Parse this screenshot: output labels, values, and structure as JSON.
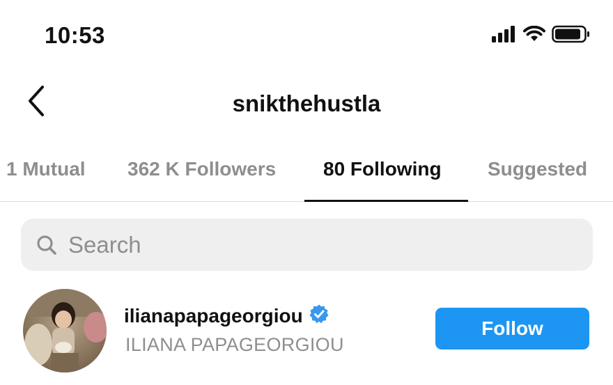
{
  "status_bar": {
    "time": "10:53",
    "icons": [
      "cellular-signal-icon",
      "wifi-icon",
      "battery-icon"
    ]
  },
  "header": {
    "back_icon": "chevron-left-icon",
    "title": "snikthehustla"
  },
  "tabs": [
    {
      "label": "1 Mutual",
      "active": false
    },
    {
      "label": "362 K Followers",
      "active": false
    },
    {
      "label": "80 Following",
      "active": true
    },
    {
      "label": "Suggested",
      "active": false
    }
  ],
  "search": {
    "placeholder": "Search",
    "value": "",
    "icon": "search-icon"
  },
  "users": [
    {
      "username": "ilianapapageorgiou",
      "full_name": "ILIANA PAPAGEORGIOU",
      "verified": true,
      "button_label": "Follow"
    }
  ],
  "colors": {
    "accent": "#1c96f2",
    "verified": "#3897f0",
    "muted_text": "#8e8e8e",
    "search_bg": "#efefef"
  }
}
